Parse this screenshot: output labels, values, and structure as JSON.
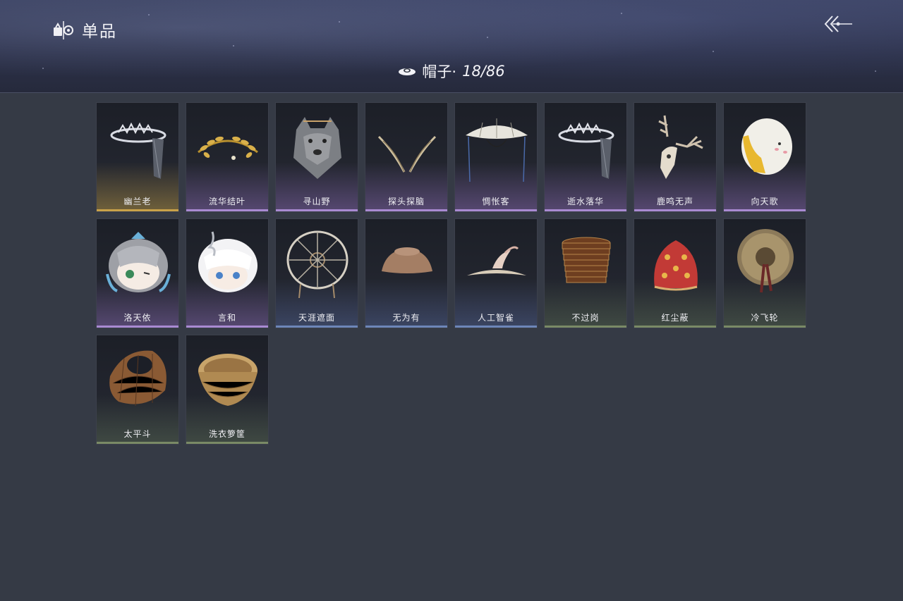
{
  "header": {
    "title": "单品",
    "category_label": "帽子·",
    "category_count": "18/86"
  },
  "items": [
    {
      "name": "幽兰老",
      "rarity": "gold",
      "icon": "veil-crown-icon"
    },
    {
      "name": "流华结叶",
      "rarity": "purple",
      "icon": "laurel-wreath-icon"
    },
    {
      "name": "寻山野",
      "rarity": "purple",
      "icon": "wolf-head-icon"
    },
    {
      "name": "探头探脑",
      "rarity": "purple",
      "icon": "antenna-feathers-icon"
    },
    {
      "name": "惆怅客",
      "rarity": "purple",
      "icon": "veiled-bamboo-hat-icon"
    },
    {
      "name": "逝水落华",
      "rarity": "purple",
      "icon": "veil-crown-icon"
    },
    {
      "name": "鹿鸣无声",
      "rarity": "purple",
      "icon": "deer-skull-icon"
    },
    {
      "name": "向天歌",
      "rarity": "purple",
      "icon": "goose-hood-icon"
    },
    {
      "name": "洛天依",
      "rarity": "purple",
      "icon": "grey-hair-mascot-icon"
    },
    {
      "name": "言和",
      "rarity": "purple",
      "icon": "white-hair-mascot-icon"
    },
    {
      "name": "天涯遮面",
      "rarity": "blue",
      "icon": "wheel-hat-icon"
    },
    {
      "name": "无为有",
      "rarity": "blue",
      "icon": "bowl-hat-icon"
    },
    {
      "name": "人工智雀",
      "rarity": "blue",
      "icon": "bird-hat-icon"
    },
    {
      "name": "不过岗",
      "rarity": "green",
      "icon": "stacked-bowls-icon"
    },
    {
      "name": "红尘蔽",
      "rarity": "green",
      "icon": "red-cloth-hood-icon"
    },
    {
      "name": "冷飞轮",
      "rarity": "green",
      "icon": "straw-hat-icon"
    },
    {
      "name": "太平斗",
      "rarity": "green",
      "icon": "woven-basket-icon"
    },
    {
      "name": "洗衣箩筐",
      "rarity": "green",
      "icon": "wicker-basket-icon"
    }
  ],
  "colors": {
    "background": "#353a45",
    "gold": "#c9a24a",
    "purple": "#a98ad2",
    "blue": "#6d86b8",
    "green": "#7a8a66"
  }
}
